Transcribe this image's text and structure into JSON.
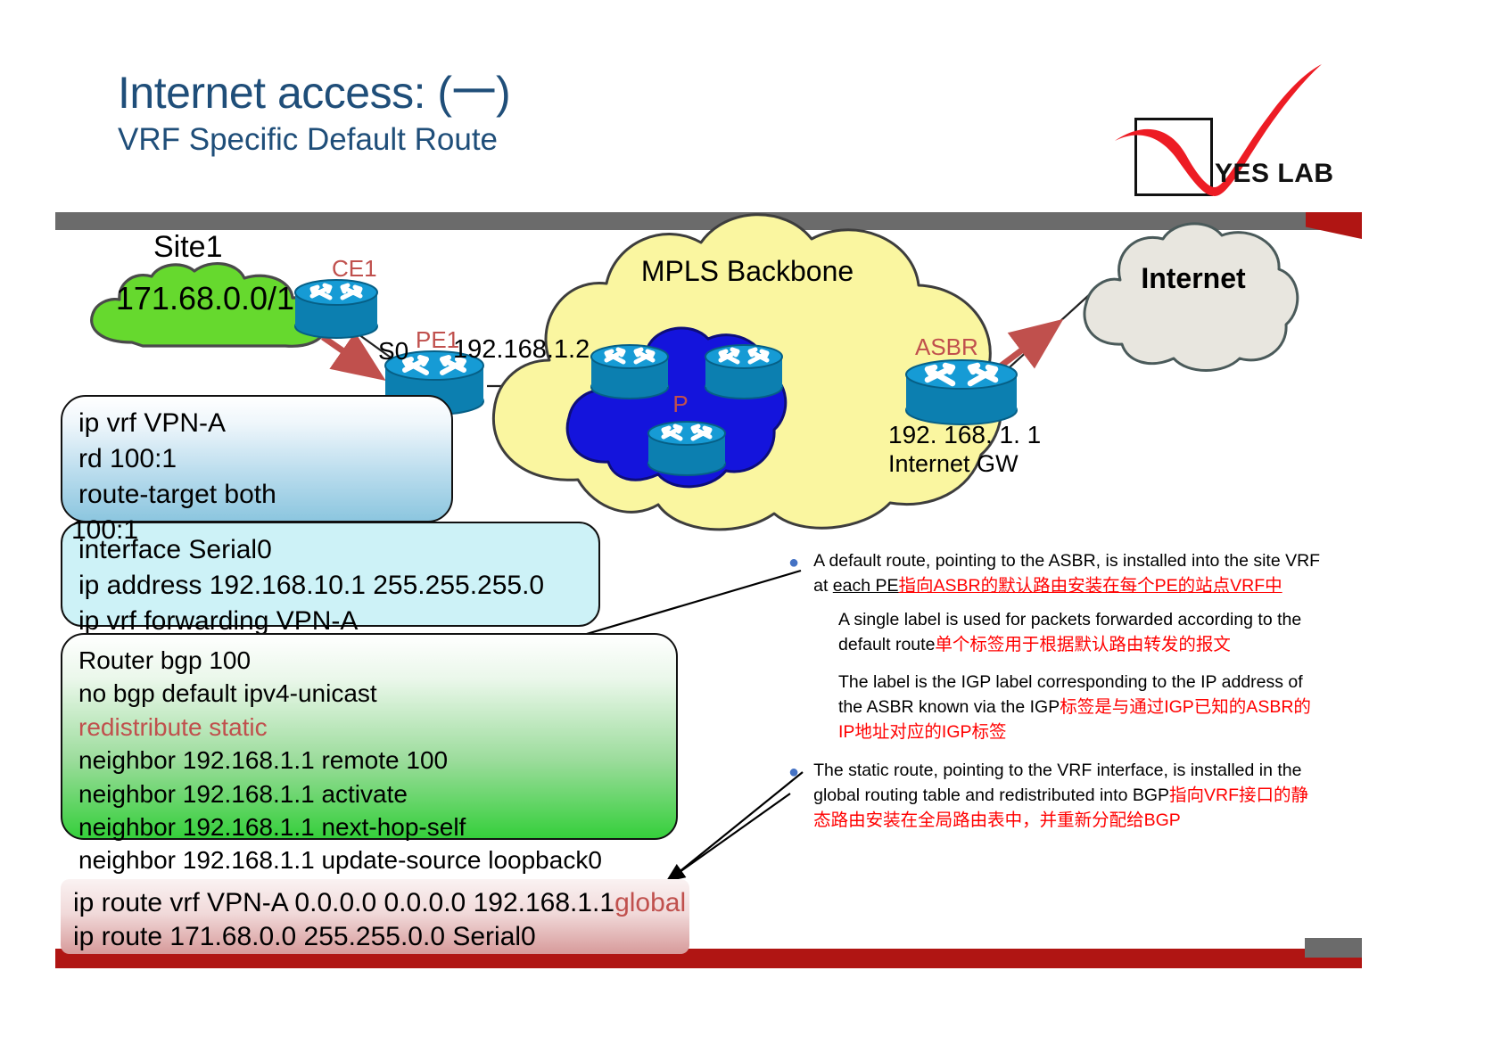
{
  "title": {
    "main": "Internet access: (一)",
    "sub": "VRF Specific Default Route"
  },
  "logo": {
    "text": "YES LAB"
  },
  "topology": {
    "site_cloud": {
      "name": "Site1",
      "network": "171.68.0.0/16"
    },
    "mpls_cloud": {
      "label": "MPLS Backbone"
    },
    "p_cloud": {
      "label": "P"
    },
    "internet_cloud": {
      "label": "Internet"
    },
    "ce1": {
      "label": "CE1"
    },
    "pe1": {
      "label": "PE1",
      "interface": "S0",
      "ip": "192.168.1.2"
    },
    "asbr": {
      "label": "ASBR",
      "ip": "192. 168. 1. 1",
      "role": "Internet GW"
    }
  },
  "config_vrf": {
    "lines": [
      "ip vrf VPN-A",
      "rd 100:1",
      "route-target both"
    ],
    "overlap_line": "100:1"
  },
  "config_interface": {
    "lines": [
      "interface Serial0",
      "ip address 192.168.10.1 255.255.255.0",
      "ip vrf forwarding VPN-A"
    ]
  },
  "config_bgp": {
    "lines": [
      {
        "text": "Router bgp 100",
        "accent": false
      },
      {
        "text": "no bgp default ipv4-unicast",
        "accent": false
      },
      {
        "text": "redistribute static",
        "accent": true
      },
      {
        "text": "neighbor 192.168.1.1 remote 100",
        "accent": false
      },
      {
        "text": "neighbor 192.168.1.1 activate",
        "accent": false
      },
      {
        "text": "neighbor 192.168.1.1 next-hop-self",
        "accent": false
      },
      {
        "text": "neighbor 192.168.1.1 update-source loopback0",
        "accent": false
      }
    ]
  },
  "config_static": {
    "line1_main": "ip route vrf VPN-A 0.0.0.0 0.0.0.0 192.168.1.1",
    "line1_accent": "global",
    "line2": "ip route 171.68.0.0 255.255.0.0 Serial0"
  },
  "bullets": [
    {
      "en_a": "A default route, pointing to the ASBR, is installed into the site VRF at ",
      "en_u": "each PE",
      "zh": "指向ASBR的默认路由安装在每个PE的站点VRF中"
    },
    {
      "en_a": "The static route, pointing to the VRF interface, is installed in the global routing table and redistributed into BGP",
      "en_u": "",
      "zh": "指向VRF接口的静态路由安装在全局路由表中，并重新分配给BGP"
    }
  ],
  "sub_paragraphs": [
    {
      "en": "A single label is used for packets forwarded according to the default route",
      "zh": "单个标签用于根据默认路由转发的报文"
    },
    {
      "en": "The label is the IGP label corresponding to the IP address of the ASBR known via the IGP",
      "zh": "标签是与通过IGP已知的ASBR的IP地址对应的IGP标签"
    }
  ],
  "colors": {
    "title": "#1F4E79",
    "accent_red": "#C0504D",
    "chinese_red": "#FF0000",
    "brand_red": "#B01513",
    "bar_gray": "#6B6B6B",
    "mpls_cloud": "#FAF6A0",
    "p_cloud": "#1414DC",
    "site_cloud": "#66D92E",
    "internet_cloud": "#E8E6DF",
    "router_blue": "#169BD5",
    "bullet_dot": "#4472C4"
  }
}
